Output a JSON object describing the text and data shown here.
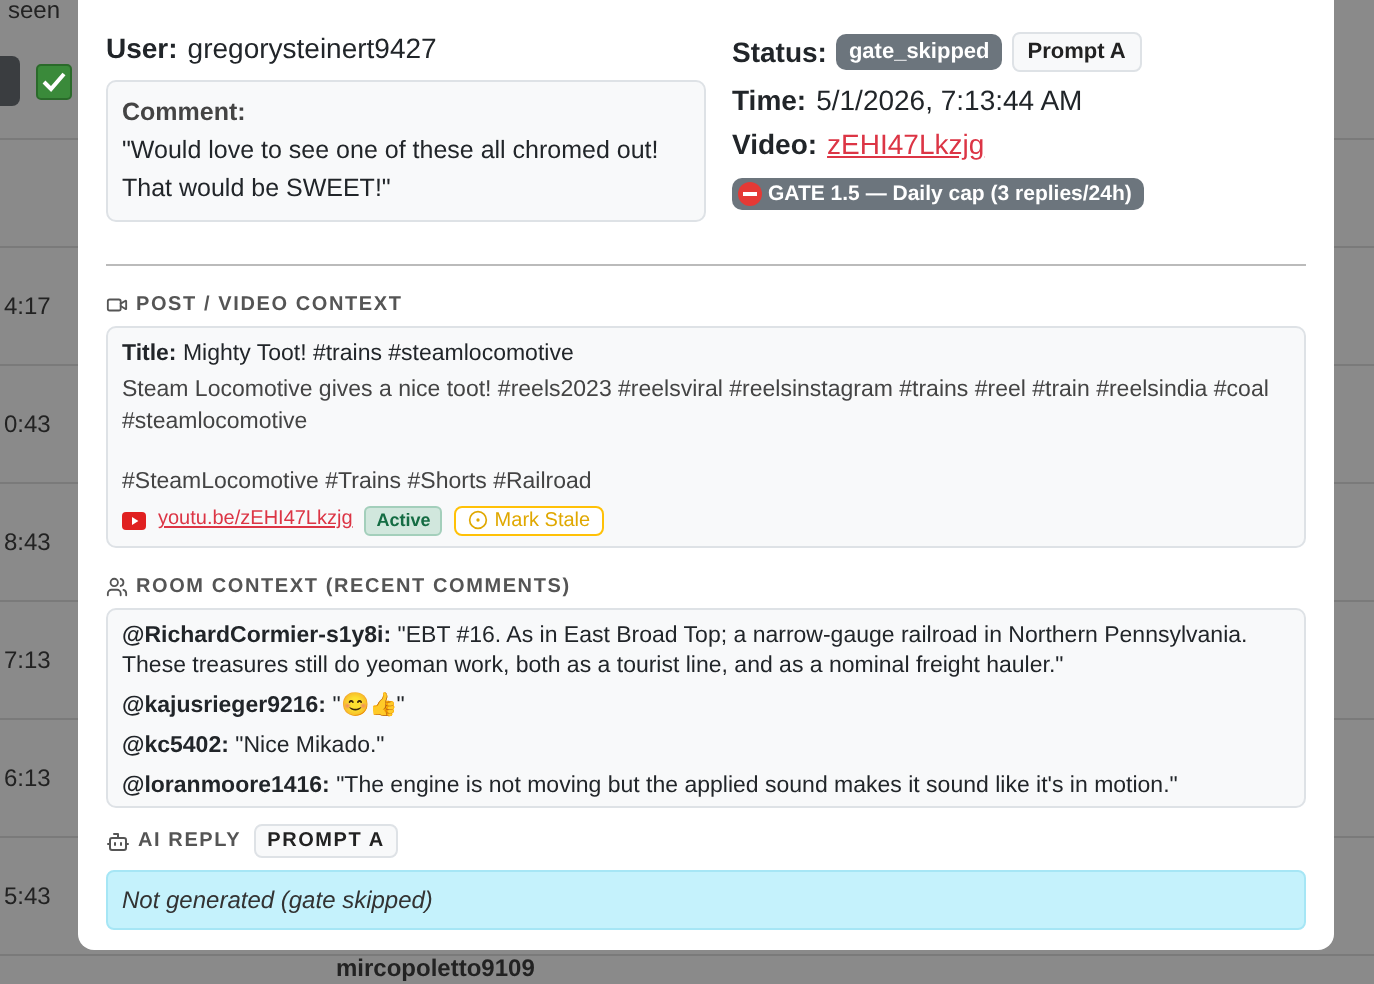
{
  "background": {
    "header_text": "seen",
    "rows": [
      {
        "time": "4:17"
      },
      {
        "time": "0:43"
      },
      {
        "time": "8:43"
      },
      {
        "time": "7:13"
      },
      {
        "time": "6:13"
      },
      {
        "time": "5:43"
      }
    ],
    "bottom_user": "mircopoletto9109"
  },
  "modal": {
    "user": {
      "label": "User:",
      "value": "gregorysteinert9427"
    },
    "comment": {
      "label": "Comment:",
      "text": "\"Would love to see one of these all chromed out! That would be SWEET!\""
    },
    "status": {
      "label": "Status:",
      "badge": "gate_skipped",
      "prompt": "Prompt A"
    },
    "time": {
      "label": "Time:",
      "value": "5/1/2026, 7:13:44 AM"
    },
    "video": {
      "label": "Video:",
      "link": "zEHI47Lkzjg"
    },
    "gate_badge": "GATE 1.5 — Daily cap (3 replies/24h)",
    "post_context": {
      "heading": "POST / VIDEO CONTEXT",
      "title_label": "Title:",
      "title": "Mighty Toot! #trains #steamlocomotive",
      "description": "Steam Locomotive gives a nice toot! #reels2023 #reelsviral #reelsinstagram #trains #reel #train #reelsindia #coal #steamlocomotive",
      "tags": "#SteamLocomotive #Trains #Shorts #Railroad",
      "link": "youtu.be/zEHI47Lkzjg",
      "status_badge": "Active",
      "stale_button": "Mark Stale"
    },
    "room_context": {
      "heading": "ROOM CONTEXT (RECENT COMMENTS)",
      "comments": [
        {
          "author": "@RichardCormier-s1y8i:",
          "text": "\"EBT #16. As in East Broad Top; a narrow-gauge railroad in Northern Pennsylvania. These treasures still do yeoman work, both as a tourist line, and as a nominal freight hauler.\""
        },
        {
          "author": "@kajusrieger9216:",
          "text": "\"😊👍\""
        },
        {
          "author": "@kc5402:",
          "text": "\"Nice Mikado.\""
        },
        {
          "author": "@loranmoore1416:",
          "text": "\"The engine is not moving but the applied sound makes it sound like it's in motion.\""
        }
      ]
    },
    "ai_reply": {
      "heading": "AI REPLY",
      "prompt": "PROMPT A",
      "text": "Not generated (gate skipped)"
    }
  }
}
